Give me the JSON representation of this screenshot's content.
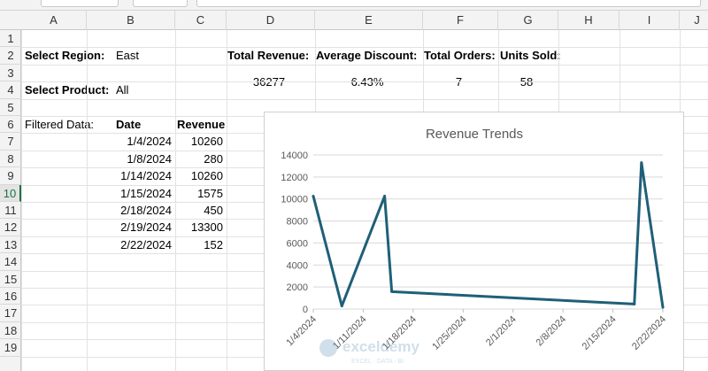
{
  "columns": [
    "A",
    "B",
    "C",
    "D",
    "E",
    "F",
    "G",
    "H",
    "I",
    "J"
  ],
  "rows": [
    "1",
    "2",
    "3",
    "4",
    "5",
    "6",
    "7",
    "8",
    "9",
    "10",
    "11",
    "12",
    "13",
    "14",
    "15",
    "16",
    "17",
    "18",
    "19"
  ],
  "active_row": "10",
  "sheet": {
    "select_region_label": "Select Region:",
    "select_region_value": "East",
    "select_product_label": "Select Product:",
    "select_product_value": "All",
    "total_revenue_label": "Total Revenue:",
    "average_discount_label": "Average Discount:",
    "total_orders_label": "Total Orders:",
    "units_sold_label": "Units Sold:",
    "total_revenue_value": "36277",
    "average_discount_value": "6.43%",
    "total_orders_value": "7",
    "units_sold_value": "58",
    "filtered_data_label": "Filtered Data:",
    "date_header": "Date",
    "revenue_header": "Revenue",
    "filtered_rows": [
      {
        "date": "1/4/2024",
        "revenue": "10260"
      },
      {
        "date": "1/8/2024",
        "revenue": "280"
      },
      {
        "date": "1/14/2024",
        "revenue": "10260"
      },
      {
        "date": "1/15/2024",
        "revenue": "1575"
      },
      {
        "date": "2/18/2024",
        "revenue": "450"
      },
      {
        "date": "2/19/2024",
        "revenue": "13300"
      },
      {
        "date": "2/22/2024",
        "revenue": "152"
      }
    ]
  },
  "watermark": {
    "brand": "exceldemy",
    "tagline": "EXCEL · DATA · BI"
  },
  "chart_data": {
    "type": "line",
    "title": "Revenue Trends",
    "xlabel": "",
    "ylabel": "",
    "x": [
      "1/4/2024",
      "1/8/2024",
      "1/14/2024",
      "1/15/2024",
      "2/18/2024",
      "2/19/2024",
      "2/22/2024"
    ],
    "series": [
      {
        "values": [
          10260,
          280,
          10260,
          1575,
          450,
          13300,
          152
        ]
      }
    ],
    "x_axis_type": "date",
    "x_ticks": [
      "1/4/2024",
      "1/11/2024",
      "1/18/2024",
      "1/25/2024",
      "2/1/2024",
      "2/8/2024",
      "2/15/2024",
      "2/22/2024"
    ],
    "y_ticks": [
      "0",
      "2000",
      "4000",
      "6000",
      "8000",
      "10000",
      "12000",
      "14000"
    ],
    "ylim": [
      0,
      14000
    ],
    "grid": true,
    "legend": "none",
    "line_color": "#1f5f78"
  }
}
